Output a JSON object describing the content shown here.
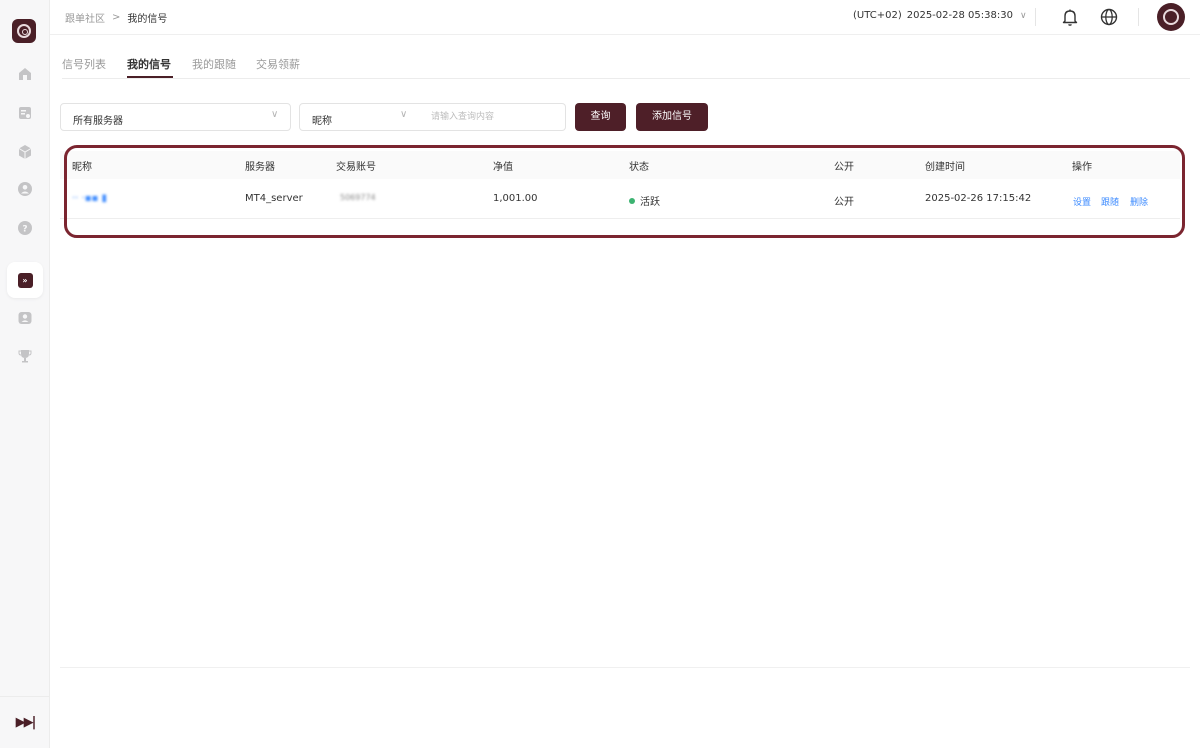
{
  "breadcrumb": {
    "parent": "跟单社区",
    "current": "我的信号"
  },
  "header": {
    "timezone": "(UTC+02)",
    "datetime": "2025-02-28 05:38:30"
  },
  "tabs": [
    {
      "label": "信号列表"
    },
    {
      "label": "我的信号"
    },
    {
      "label": "我的跟随"
    },
    {
      "label": "交易领薪"
    }
  ],
  "filters": {
    "server_select": "所有服务器",
    "field_select": "昵称",
    "search_placeholder": "请输入查询内容",
    "query_button": "查询",
    "add_button": "添加信号"
  },
  "table": {
    "headers": [
      "昵称",
      "服务器",
      "交易账号",
      "净值",
      "状态",
      "公开",
      "创建时间",
      "操作"
    ],
    "rows": [
      {
        "nickname": "·· ·▪▪ ▮",
        "server": "MT4_server",
        "account": "5069774",
        "equity": "1,001.00",
        "status": "活跃",
        "public": "公开",
        "created": "2025-02-26 17:15:42",
        "actions": [
          "设置",
          "跟随",
          "删除"
        ]
      }
    ]
  },
  "colors": {
    "brand": "#4e1f28",
    "highlight": "#7b2530",
    "link": "#3d8bff",
    "status_active": "#3cb371"
  },
  "icons": {
    "sidebar": [
      "home-icon",
      "report-icon",
      "cube-icon",
      "user-icon",
      "help-icon",
      "signal-icon",
      "user-card-icon",
      "trophy-icon"
    ],
    "header": [
      "bell-icon",
      "globe-icon"
    ]
  }
}
